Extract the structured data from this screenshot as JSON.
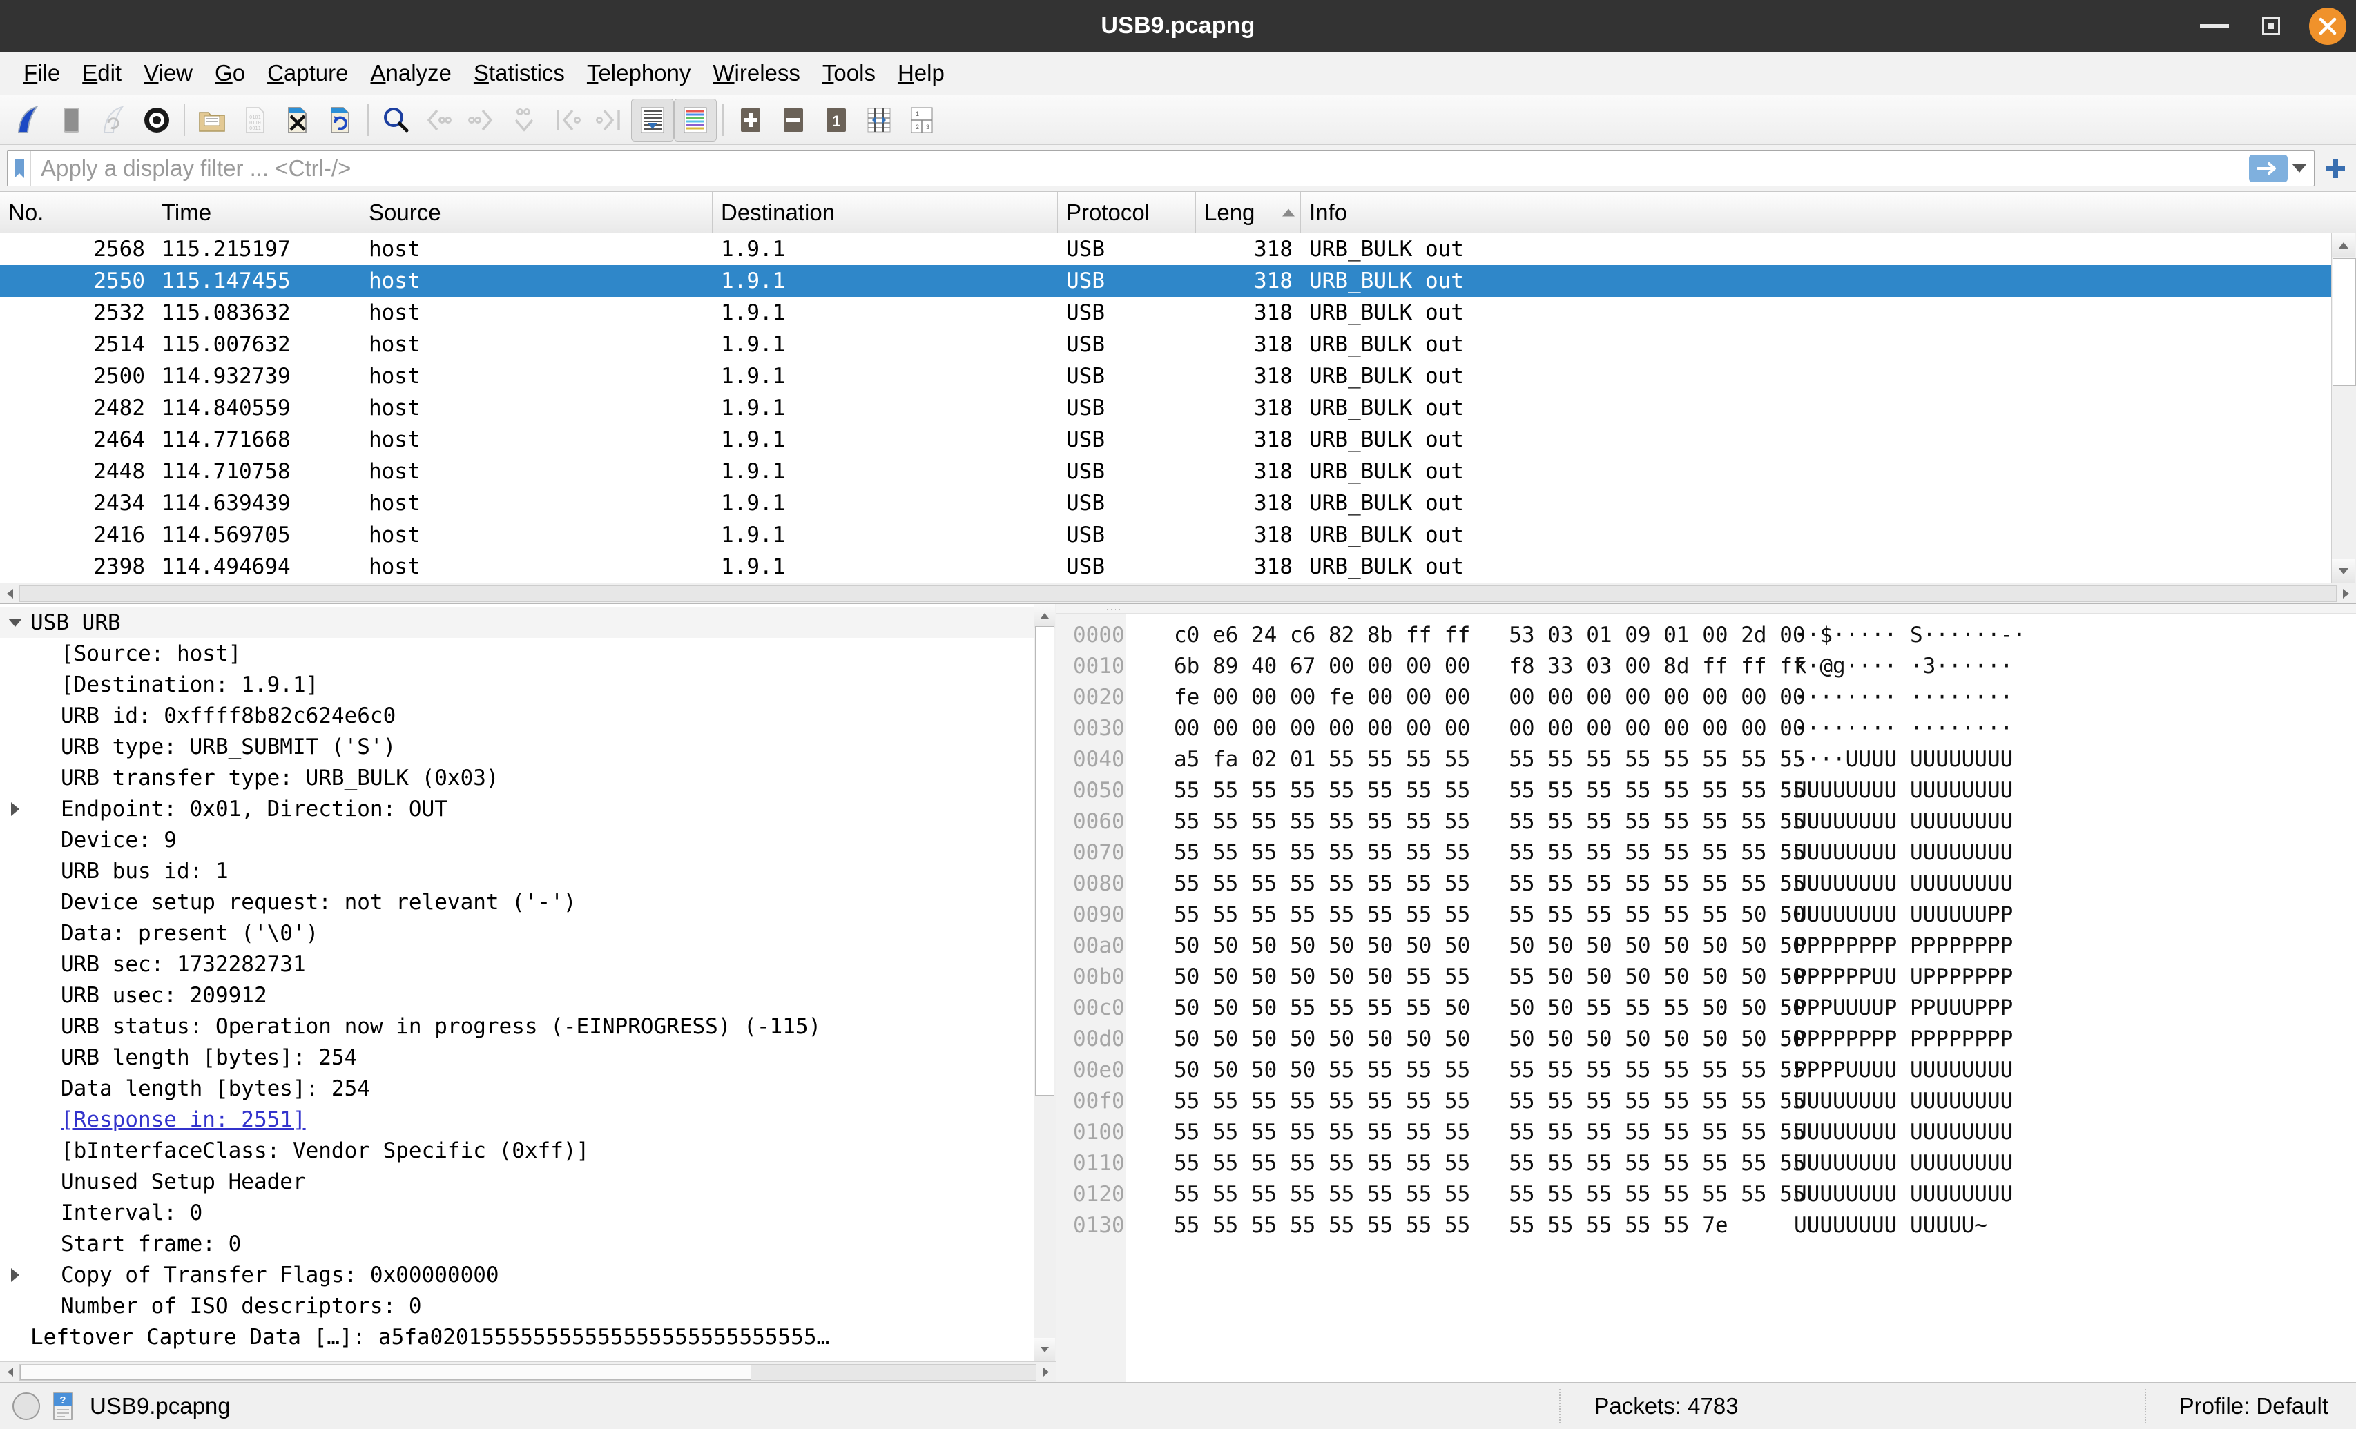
{
  "window": {
    "title": "USB9.pcapng",
    "minimize_label": "Minimize",
    "maximize_label": "Maximize",
    "close_label": "Close"
  },
  "menu": [
    {
      "label": "File",
      "accel": "F"
    },
    {
      "label": "Edit",
      "accel": "E"
    },
    {
      "label": "View",
      "accel": "V"
    },
    {
      "label": "Go",
      "accel": "G"
    },
    {
      "label": "Capture",
      "accel": "C"
    },
    {
      "label": "Analyze",
      "accel": "A"
    },
    {
      "label": "Statistics",
      "accel": "S"
    },
    {
      "label": "Telephony",
      "accel": "T"
    },
    {
      "label": "Wireless",
      "accel": "W"
    },
    {
      "label": "Tools",
      "accel": "T"
    },
    {
      "label": "Help",
      "accel": "H"
    }
  ],
  "toolbar": {
    "items": [
      {
        "name": "start-capture-icon",
        "tip": "Start capturing packets",
        "enabled": true
      },
      {
        "name": "stop-capture-icon",
        "tip": "Stop capturing packets",
        "enabled": true
      },
      {
        "name": "restart-capture-icon",
        "tip": "Restart current capture",
        "enabled": false
      },
      {
        "name": "capture-options-icon",
        "tip": "Capture options",
        "enabled": true
      },
      {
        "name": "open-file-icon",
        "tip": "Open a capture file",
        "enabled": true
      },
      {
        "name": "save-file-icon",
        "tip": "Save this capture file",
        "enabled": false
      },
      {
        "name": "close-file-icon",
        "tip": "Close this capture file",
        "enabled": true
      },
      {
        "name": "reload-file-icon",
        "tip": "Reload this file",
        "enabled": true
      },
      {
        "name": "find-packet-icon",
        "tip": "Find a packet",
        "enabled": true
      },
      {
        "name": "go-back-icon",
        "tip": "Go back in packet history",
        "enabled": false
      },
      {
        "name": "go-forward-icon",
        "tip": "Go forward in packet history",
        "enabled": false
      },
      {
        "name": "go-to-packet-icon",
        "tip": "Go to the packet",
        "enabled": false
      },
      {
        "name": "go-first-packet-icon",
        "tip": "Go to the first packet",
        "enabled": false
      },
      {
        "name": "go-last-packet-icon",
        "tip": "Go to the last packet",
        "enabled": false
      },
      {
        "name": "autoscroll-icon",
        "tip": "Auto scroll in live capture",
        "enabled": true,
        "pressed": true
      },
      {
        "name": "colorize-icon",
        "tip": "Colorize packet list",
        "enabled": true,
        "pressed": true
      },
      {
        "name": "zoom-in-icon",
        "tip": "Zoom in",
        "enabled": true
      },
      {
        "name": "zoom-out-icon",
        "tip": "Zoom out",
        "enabled": true
      },
      {
        "name": "zoom-reset-icon",
        "tip": "Normal size",
        "label": "1",
        "enabled": true
      },
      {
        "name": "resize-columns-icon",
        "tip": "Resize columns",
        "enabled": true
      },
      {
        "name": "layout-icon",
        "tip": "Layout",
        "enabled": true
      }
    ]
  },
  "filter": {
    "placeholder": "Apply a display filter ... <Ctrl-/>",
    "value": "",
    "bookmark_icon": "bookmark-icon",
    "apply_icon": "apply-filter-arrow-icon",
    "dropdown_icon": "chevron-down-icon",
    "add_icon": "add-filter-plus-icon"
  },
  "packet_list": {
    "columns": [
      {
        "key": "no",
        "label": "No."
      },
      {
        "key": "time",
        "label": "Time"
      },
      {
        "key": "source",
        "label": "Source"
      },
      {
        "key": "destination",
        "label": "Destination"
      },
      {
        "key": "protocol",
        "label": "Protocol"
      },
      {
        "key": "length",
        "label": "Leng",
        "sorted": "asc"
      },
      {
        "key": "info",
        "label": "Info"
      }
    ],
    "rows": [
      {
        "no": "2568",
        "time": "115.215197",
        "source": "host",
        "destination": "1.9.1",
        "protocol": "USB",
        "length": "318",
        "info": "URB_BULK out",
        "selected": false
      },
      {
        "no": "2550",
        "time": "115.147455",
        "source": "host",
        "destination": "1.9.1",
        "protocol": "USB",
        "length": "318",
        "info": "URB_BULK out",
        "selected": true
      },
      {
        "no": "2532",
        "time": "115.083632",
        "source": "host",
        "destination": "1.9.1",
        "protocol": "USB",
        "length": "318",
        "info": "URB_BULK out",
        "selected": false
      },
      {
        "no": "2514",
        "time": "115.007632",
        "source": "host",
        "destination": "1.9.1",
        "protocol": "USB",
        "length": "318",
        "info": "URB_BULK out",
        "selected": false
      },
      {
        "no": "2500",
        "time": "114.932739",
        "source": "host",
        "destination": "1.9.1",
        "protocol": "USB",
        "length": "318",
        "info": "URB_BULK out",
        "selected": false
      },
      {
        "no": "2482",
        "time": "114.840559",
        "source": "host",
        "destination": "1.9.1",
        "protocol": "USB",
        "length": "318",
        "info": "URB_BULK out",
        "selected": false
      },
      {
        "no": "2464",
        "time": "114.771668",
        "source": "host",
        "destination": "1.9.1",
        "protocol": "USB",
        "length": "318",
        "info": "URB_BULK out",
        "selected": false
      },
      {
        "no": "2448",
        "time": "114.710758",
        "source": "host",
        "destination": "1.9.1",
        "protocol": "USB",
        "length": "318",
        "info": "URB_BULK out",
        "selected": false
      },
      {
        "no": "2434",
        "time": "114.639439",
        "source": "host",
        "destination": "1.9.1",
        "protocol": "USB",
        "length": "318",
        "info": "URB_BULK out",
        "selected": false
      },
      {
        "no": "2416",
        "time": "114.569705",
        "source": "host",
        "destination": "1.9.1",
        "protocol": "USB",
        "length": "318",
        "info": "URB_BULK out",
        "selected": false
      },
      {
        "no": "2398",
        "time": "114.494694",
        "source": "host",
        "destination": "1.9.1",
        "protocol": "USB",
        "length": "318",
        "info": "URB_BULK out",
        "selected": false
      }
    ]
  },
  "packet_detail": {
    "rows": [
      {
        "text": "USB URB",
        "indent": 0,
        "twisty": "down",
        "root": true
      },
      {
        "text": "[Source: host]",
        "indent": 1,
        "twisty": "none"
      },
      {
        "text": "[Destination: 1.9.1]",
        "indent": 1,
        "twisty": "none"
      },
      {
        "text": "URB id: 0xffff8b82c624e6c0",
        "indent": 1,
        "twisty": "none"
      },
      {
        "text": "URB type: URB_SUBMIT ('S')",
        "indent": 1,
        "twisty": "none"
      },
      {
        "text": "URB transfer type: URB_BULK (0x03)",
        "indent": 1,
        "twisty": "none"
      },
      {
        "text": "Endpoint: 0x01, Direction: OUT",
        "indent": 1,
        "twisty": "right"
      },
      {
        "text": "Device: 9",
        "indent": 1,
        "twisty": "none"
      },
      {
        "text": "URB bus id: 1",
        "indent": 1,
        "twisty": "none"
      },
      {
        "text": "Device setup request: not relevant ('-')",
        "indent": 1,
        "twisty": "none"
      },
      {
        "text": "Data: present ('\\0')",
        "indent": 1,
        "twisty": "none"
      },
      {
        "text": "URB sec: 1732282731",
        "indent": 1,
        "twisty": "none"
      },
      {
        "text": "URB usec: 209912",
        "indent": 1,
        "twisty": "none"
      },
      {
        "text": "URB status: Operation now in progress (-EINPROGRESS) (-115)",
        "indent": 1,
        "twisty": "none"
      },
      {
        "text": "URB length [bytes]: 254",
        "indent": 1,
        "twisty": "none"
      },
      {
        "text": "Data length [bytes]: 254",
        "indent": 1,
        "twisty": "none"
      },
      {
        "text": "[Response in: 2551]",
        "indent": 1,
        "twisty": "none",
        "link": true
      },
      {
        "text": "[bInterfaceClass: Vendor Specific (0xff)]",
        "indent": 1,
        "twisty": "none"
      },
      {
        "text": "Unused Setup Header",
        "indent": 1,
        "twisty": "none"
      },
      {
        "text": "Interval: 0",
        "indent": 1,
        "twisty": "none"
      },
      {
        "text": "Start frame: 0",
        "indent": 1,
        "twisty": "none"
      },
      {
        "text": "Copy of Transfer Flags: 0x00000000",
        "indent": 1,
        "twisty": "right"
      },
      {
        "text": "Number of ISO descriptors: 0",
        "indent": 1,
        "twisty": "none"
      },
      {
        "text": "Leftover Capture Data […]: a5fa020155555555555555555555555555…",
        "indent": 0,
        "twisty": "none"
      }
    ]
  },
  "hex_dump": {
    "rows": [
      {
        "offset": "0000",
        "left": "c0 e6 24 c6 82 8b ff ff",
        "right": "53 03 01 09 01 00 2d 00",
        "ascii_left": "··$·····",
        "ascii_right": "S······-·"
      },
      {
        "offset": "0010",
        "left": "6b 89 40 67 00 00 00 00",
        "right": "f8 33 03 00 8d ff ff ff",
        "ascii_left": "k·@g····",
        "ascii_right": "·3······"
      },
      {
        "offset": "0020",
        "left": "fe 00 00 00 fe 00 00 00",
        "right": "00 00 00 00 00 00 00 00",
        "ascii_left": "········",
        "ascii_right": "········"
      },
      {
        "offset": "0030",
        "left": "00 00 00 00 00 00 00 00",
        "right": "00 00 00 00 00 00 00 00",
        "ascii_left": "········",
        "ascii_right": "········"
      },
      {
        "offset": "0040",
        "left": "a5 fa 02 01 55 55 55 55",
        "right": "55 55 55 55 55 55 55 55",
        "ascii_left": "····UUUU",
        "ascii_right": "UUUUUUUU"
      },
      {
        "offset": "0050",
        "left": "55 55 55 55 55 55 55 55",
        "right": "55 55 55 55 55 55 55 55",
        "ascii_left": "UUUUUUUU",
        "ascii_right": "UUUUUUUU"
      },
      {
        "offset": "0060",
        "left": "55 55 55 55 55 55 55 55",
        "right": "55 55 55 55 55 55 55 55",
        "ascii_left": "UUUUUUUU",
        "ascii_right": "UUUUUUUU"
      },
      {
        "offset": "0070",
        "left": "55 55 55 55 55 55 55 55",
        "right": "55 55 55 55 55 55 55 55",
        "ascii_left": "UUUUUUUU",
        "ascii_right": "UUUUUUUU"
      },
      {
        "offset": "0080",
        "left": "55 55 55 55 55 55 55 55",
        "right": "55 55 55 55 55 55 55 55",
        "ascii_left": "UUUUUUUU",
        "ascii_right": "UUUUUUUU"
      },
      {
        "offset": "0090",
        "left": "55 55 55 55 55 55 55 55",
        "right": "55 55 55 55 55 55 50 50",
        "ascii_left": "UUUUUUUU",
        "ascii_right": "UUUUUUPP"
      },
      {
        "offset": "00a0",
        "left": "50 50 50 50 50 50 50 50",
        "right": "50 50 50 50 50 50 50 50",
        "ascii_left": "PPPPPPPP",
        "ascii_right": "PPPPPPPP"
      },
      {
        "offset": "00b0",
        "left": "50 50 50 50 50 50 55 55",
        "right": "55 50 50 50 50 50 50 50",
        "ascii_left": "PPPPPPUU",
        "ascii_right": "UPPPPPPP"
      },
      {
        "offset": "00c0",
        "left": "50 50 50 55 55 55 55 50",
        "right": "50 50 55 55 55 50 50 50",
        "ascii_left": "PPPUUUUP",
        "ascii_right": "PPUUUPPP"
      },
      {
        "offset": "00d0",
        "left": "50 50 50 50 50 50 50 50",
        "right": "50 50 50 50 50 50 50 50",
        "ascii_left": "PPPPPPPP",
        "ascii_right": "PPPPPPPP"
      },
      {
        "offset": "00e0",
        "left": "50 50 50 50 55 55 55 55",
        "right": "55 55 55 55 55 55 55 55",
        "ascii_left": "PPPPUUUU",
        "ascii_right": "UUUUUUUU"
      },
      {
        "offset": "00f0",
        "left": "55 55 55 55 55 55 55 55",
        "right": "55 55 55 55 55 55 55 55",
        "ascii_left": "UUUUUUUU",
        "ascii_right": "UUUUUUUU"
      },
      {
        "offset": "0100",
        "left": "55 55 55 55 55 55 55 55",
        "right": "55 55 55 55 55 55 55 55",
        "ascii_left": "UUUUUUUU",
        "ascii_right": "UUUUUUUU"
      },
      {
        "offset": "0110",
        "left": "55 55 55 55 55 55 55 55",
        "right": "55 55 55 55 55 55 55 55",
        "ascii_left": "UUUUUUUU",
        "ascii_right": "UUUUUUUU"
      },
      {
        "offset": "0120",
        "left": "55 55 55 55 55 55 55 55",
        "right": "55 55 55 55 55 55 55 55",
        "ascii_left": "UUUUUUUU",
        "ascii_right": "UUUUUUUU"
      },
      {
        "offset": "0130",
        "left": "55 55 55 55 55 55 55 55",
        "right": "55 55 55 55 55 7e",
        "ascii_left": "UUUUUUUU",
        "ascii_right": "UUUUU~"
      }
    ]
  },
  "status_bar": {
    "expert_icon": "expert-info-icon",
    "help_icon": "capture-file-properties-icon",
    "file_name": "USB9.pcapng",
    "packets": "Packets: 4783",
    "profile": "Profile: Default"
  },
  "colors": {
    "selection_blue": "#2f87c9",
    "title_bar": "#333333",
    "close_orange": "#f0922b",
    "link_blue": "#3333cc"
  }
}
